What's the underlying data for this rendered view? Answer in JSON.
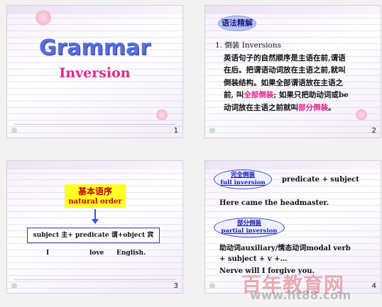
{
  "slides": [
    {
      "number": "1",
      "title": "Grammar",
      "subtitle": "Inversion"
    },
    {
      "number": "2",
      "badge": "语法精解",
      "heading": "1. 倒装 Inversions",
      "line1": "英语句子的自然顺序是主语在前,谓语",
      "line2": "在后。把谓语动词放在主语之前,就叫",
      "line3": "倒装结构。如果全部谓语放在主语之",
      "line4_pre": "前, 叫",
      "line4_pink": "全部倒装",
      "line4_post": "; 如果只把助动词或be",
      "line5_pre": "动词放在主语之前就叫",
      "line5_pink": "部分倒装",
      "line5_post": "。"
    },
    {
      "number": "3",
      "box_zh": "基本语序",
      "box_en": "natural order",
      "order": "subject 主+ predicate 谓+object 宾",
      "example": [
        "I",
        "love",
        "English."
      ]
    },
    {
      "number": "4",
      "full_zh": "完全倒装",
      "full_en": "full inversion",
      "full_formula": "predicate + subject",
      "full_example": "Here came the headmaster.",
      "partial_zh": "部分倒装",
      "partial_en": "partial inversion",
      "partial_line1": "助动词auxiliary/情态动词modal verb",
      "partial_line2": "+ subject + v +…",
      "partial_example": "Nerve will I forgive you."
    }
  ],
  "watermark": {
    "text": "百年教育网",
    "url": "www.ht88.com"
  },
  "colors": {
    "title_blue": "#5a6ed8",
    "subtitle_pink": "#e0288c",
    "highlight_pink": "#e0208a",
    "yellow_box": "#ffff24",
    "oval_blue": "#3848c8"
  }
}
